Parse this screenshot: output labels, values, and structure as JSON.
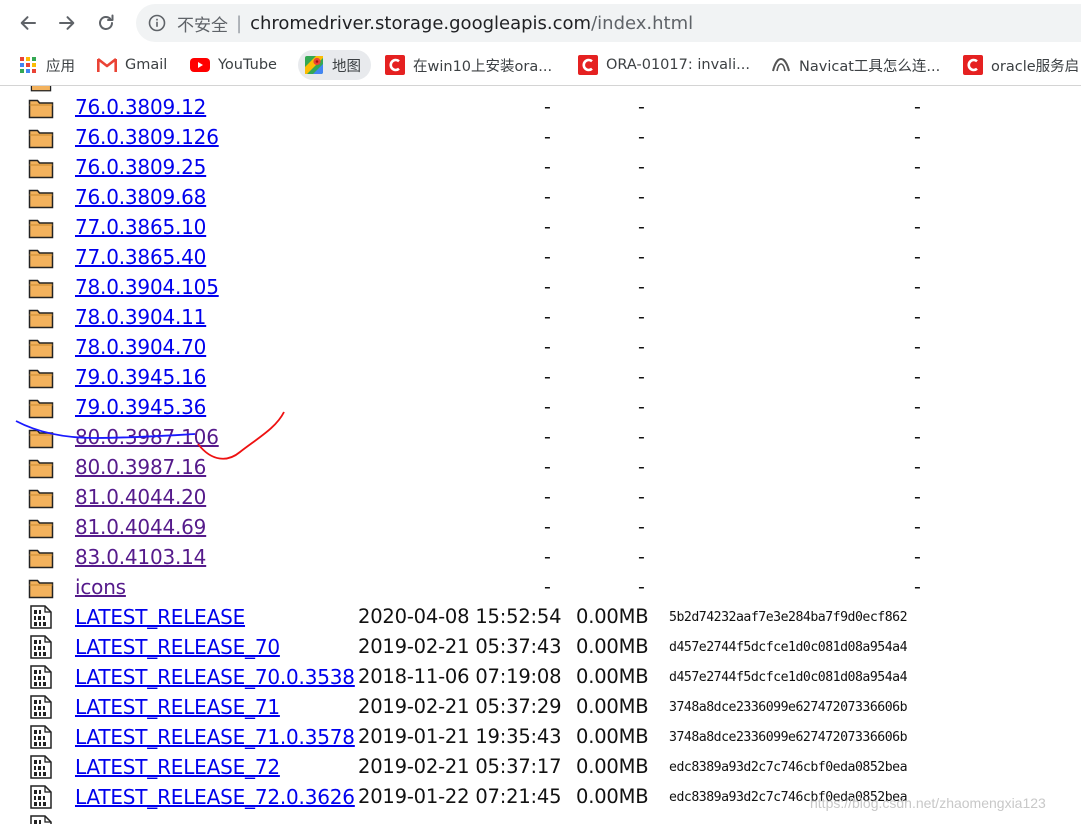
{
  "browser": {
    "insecure_label": "不安全",
    "url_host": "chromedriver.storage.googleapis.com",
    "url_path": "/index.html"
  },
  "bookmarks": [
    {
      "label": "应用",
      "icon": "apps-grid-icon"
    },
    {
      "label": "Gmail",
      "icon": "gmail-icon"
    },
    {
      "label": "YouTube",
      "icon": "youtube-icon"
    },
    {
      "label": "地图",
      "icon": "maps-icon"
    },
    {
      "label": "在win10上安装ora...",
      "icon": "csdn-icon"
    },
    {
      "label": "ORA-01017: invali...",
      "icon": "csdn-icon"
    },
    {
      "label": "Navicat工具怎么连...",
      "icon": "navicat-icon"
    },
    {
      "label": "oracle服务启",
      "icon": "csdn-icon"
    }
  ],
  "listing": {
    "folders": [
      {
        "name": "76.0.3809.12",
        "visited": false
      },
      {
        "name": "76.0.3809.126",
        "visited": false
      },
      {
        "name": "76.0.3809.25",
        "visited": false
      },
      {
        "name": "76.0.3809.68",
        "visited": false
      },
      {
        "name": "77.0.3865.10",
        "visited": false
      },
      {
        "name": "77.0.3865.40",
        "visited": false
      },
      {
        "name": "78.0.3904.105",
        "visited": false
      },
      {
        "name": "78.0.3904.11",
        "visited": false
      },
      {
        "name": "78.0.3904.70",
        "visited": false
      },
      {
        "name": "79.0.3945.16",
        "visited": false
      },
      {
        "name": "79.0.3945.36",
        "visited": false
      },
      {
        "name": "80.0.3987.106",
        "visited": true
      },
      {
        "name": "80.0.3987.16",
        "visited": true
      },
      {
        "name": "81.0.4044.20",
        "visited": true
      },
      {
        "name": "81.0.4044.69",
        "visited": true
      },
      {
        "name": "83.0.4103.14",
        "visited": true
      },
      {
        "name": "icons",
        "visited": true
      }
    ],
    "folder_placeholder": "-",
    "files": [
      {
        "name": "LATEST_RELEASE",
        "date": "2020-04-08 15:52:54",
        "size": "0.00MB",
        "hash": "5b2d74232aaf7e3e284ba7f9d0ecf862"
      },
      {
        "name": "LATEST_RELEASE_70",
        "date": "2019-02-21 05:37:43",
        "size": "0.00MB",
        "hash": "d457e2744f5dcfce1d0c081d08a954a4"
      },
      {
        "name": "LATEST_RELEASE_70.0.3538",
        "date": "2018-11-06 07:19:08",
        "size": "0.00MB",
        "hash": "d457e2744f5dcfce1d0c081d08a954a4"
      },
      {
        "name": "LATEST_RELEASE_71",
        "date": "2019-02-21 05:37:29",
        "size": "0.00MB",
        "hash": "3748a8dce2336099e62747207336606b"
      },
      {
        "name": "LATEST_RELEASE_71.0.3578",
        "date": "2019-01-21 19:35:43",
        "size": "0.00MB",
        "hash": "3748a8dce2336099e62747207336606b"
      },
      {
        "name": "LATEST_RELEASE_72",
        "date": "2019-02-21 05:37:17",
        "size": "0.00MB",
        "hash": "edc8389a93d2c7c746cbf0eda0852bea"
      },
      {
        "name": "LATEST_RELEASE_72.0.3626",
        "date": "2019-01-22 07:21:45",
        "size": "0.00MB",
        "hash": "edc8389a93d2c7c746cbf0eda0852bea"
      }
    ]
  },
  "watermark": "https://blog.csdn.net/zhaomengxia123"
}
